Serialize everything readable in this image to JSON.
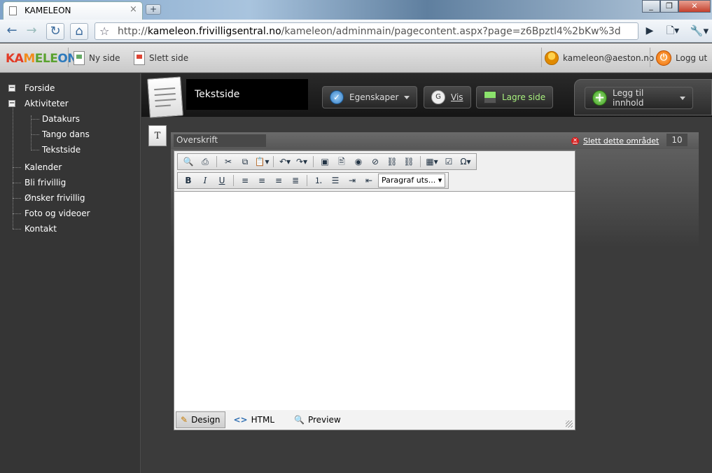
{
  "browser": {
    "tab_title": "KAMELEON",
    "tab_close": "×",
    "new_tab": "+",
    "url_host": "kameleon.frivilligsentral.no",
    "url_scheme": "http://",
    "url_path": "/kameleon/adminmain/pagecontent.aspx?page=z6Bpztl4%2bKw%3d"
  },
  "appbar": {
    "logo": {
      "p1": "KA",
      "p2": "M",
      "p3": "ELE",
      "p4": "ON"
    },
    "new_page": "Ny side",
    "delete_page": "Slett side",
    "user": "kameleon@aeston.no",
    "logout": "Logg ut"
  },
  "sidebar": {
    "items": [
      {
        "label": "Forside",
        "level": 0,
        "box": "−"
      },
      {
        "label": "Aktiviteter",
        "level": 0,
        "box": "−"
      },
      {
        "label": "Datakurs",
        "level": 1
      },
      {
        "label": "Tango dans",
        "level": 1
      },
      {
        "label": "Tekstside",
        "level": 1
      },
      {
        "label": "Kalender",
        "level": 0
      },
      {
        "label": "Bli frivillig",
        "level": 0
      },
      {
        "label": "Ønsker frivillig",
        "level": 0
      },
      {
        "label": "Foto og videoer",
        "level": 0
      },
      {
        "label": "Kontakt",
        "level": 0
      }
    ]
  },
  "toolbar": {
    "page_type": "Tekstside",
    "properties": "Egenskaper",
    "view": "Vis",
    "save": "Lagre side",
    "add_content": "Legg til innhold"
  },
  "region": {
    "icon_letter": "T",
    "heading_placeholder": "Overskrift",
    "delete_label": "Slett dette området",
    "order_number": "10"
  },
  "editor": {
    "paragraph_style": "Paragraf uts...",
    "modes": [
      "Design",
      "HTML",
      "Preview"
    ],
    "active_mode": "Design"
  }
}
